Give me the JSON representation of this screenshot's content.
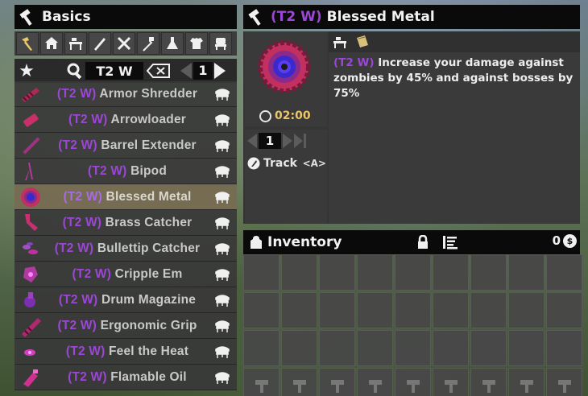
{
  "left_panel": {
    "title": "Basics",
    "categories": [
      "hammer-icon",
      "house-icon",
      "workbench-icon",
      "weapon-icon",
      "tools-icon",
      "fork-icon",
      "science-icon",
      "armor-icon",
      "chair-icon"
    ],
    "search_value": "T2 W",
    "page": "1"
  },
  "recipes": [
    {
      "tier": "(T2 W)",
      "name": "Armor Shredder",
      "icon": "shredder",
      "selected": false
    },
    {
      "tier": "(T2 W)",
      "name": "Arrowloader",
      "icon": "arrowloader",
      "selected": false
    },
    {
      "tier": "(T2 W)",
      "name": "Barrel Extender",
      "icon": "barrel",
      "selected": false
    },
    {
      "tier": "(T2 W)",
      "name": "Bipod",
      "icon": "bipod",
      "selected": false
    },
    {
      "tier": "(T2 W)",
      "name": "Blessed Metal",
      "icon": "blessed",
      "selected": true
    },
    {
      "tier": "(T2 W)",
      "name": "Brass Catcher",
      "icon": "brass",
      "selected": false
    },
    {
      "tier": "(T2 W)",
      "name": "Bullettip Catcher",
      "icon": "bullettip",
      "selected": false
    },
    {
      "tier": "(T2 W)",
      "name": "Cripple Em",
      "icon": "cripple",
      "selected": false
    },
    {
      "tier": "(T2 W)",
      "name": "Drum Magazine",
      "icon": "drum",
      "selected": false
    },
    {
      "tier": "(T2 W)",
      "name": "Ergonomic Grip",
      "icon": "grip",
      "selected": false
    },
    {
      "tier": "(T2 W)",
      "name": "Feel the Heat",
      "icon": "heat",
      "selected": false
    },
    {
      "tier": "(T2 W)",
      "name": "Flamable Oil",
      "icon": "oil",
      "selected": false
    }
  ],
  "detail": {
    "tier": "(T2 W)",
    "name": "Blessed Metal",
    "craft_time": "02:00",
    "quantity": "1",
    "track_label": "Track",
    "track_key": "<A>",
    "desc_tier": "(T2 W)",
    "description": " Increase your damage against zombies by 45% and against bosses by 75%"
  },
  "inventory": {
    "title": "Inventory",
    "coins": "0",
    "coin_symbol": "$"
  },
  "colors": {
    "tier_purple": "#9c46d6",
    "time_gold": "#e9c66c",
    "mod_magenta": "#d0306a"
  }
}
